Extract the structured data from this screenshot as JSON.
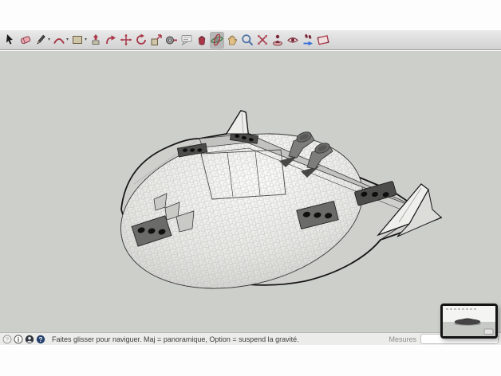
{
  "toolbar": {
    "active_tool": "orbit",
    "tools": [
      {
        "id": "select",
        "icon": "select-icon",
        "flyout": false
      },
      {
        "id": "eraser",
        "icon": "eraser-icon",
        "flyout": false
      },
      {
        "id": "line",
        "icon": "pencil-icon",
        "flyout": true
      },
      {
        "id": "arc",
        "icon": "arc-icon",
        "flyout": true
      },
      {
        "id": "shapes",
        "icon": "rectangle-icon",
        "flyout": true
      },
      {
        "id": "push-pull",
        "icon": "push-pull-icon",
        "flyout": false
      },
      {
        "id": "follow-me",
        "icon": "follow-me-icon",
        "flyout": false
      },
      {
        "id": "move",
        "icon": "move-icon",
        "flyout": false
      },
      {
        "id": "rotate",
        "icon": "rotate-icon",
        "flyout": false
      },
      {
        "id": "scale",
        "icon": "scale-icon",
        "flyout": false
      },
      {
        "id": "tape-measure",
        "icon": "tape-measure-icon",
        "flyout": false
      },
      {
        "id": "text",
        "icon": "text-label-icon",
        "flyout": false
      },
      {
        "id": "paint-bucket",
        "icon": "paint-bucket-icon",
        "flyout": false
      },
      {
        "id": "orbit",
        "icon": "orbit-icon",
        "flyout": false
      },
      {
        "id": "pan",
        "icon": "pan-hand-icon",
        "flyout": false
      },
      {
        "id": "zoom",
        "icon": "zoom-icon",
        "flyout": false
      },
      {
        "id": "zoom-extents",
        "icon": "zoom-extents-icon",
        "flyout": false
      },
      {
        "id": "position-camera",
        "icon": "position-camera-icon",
        "flyout": false
      },
      {
        "id": "look-around",
        "icon": "look-around-icon",
        "flyout": false
      },
      {
        "id": "walk",
        "icon": "walk-icon",
        "flyout": false
      },
      {
        "id": "section-plane",
        "icon": "section-plane-icon",
        "flyout": false
      }
    ]
  },
  "viewport": {
    "background_color": "#cdcfca",
    "model": "flying-saucer-aircraft-model"
  },
  "preview_window": {
    "visible": true,
    "content": "side-view-of-saucer-model"
  },
  "statusbar": {
    "icons": [
      {
        "id": "geolocation-icon"
      },
      {
        "id": "attribution-icon"
      },
      {
        "id": "account-icon"
      },
      {
        "id": "help-icon"
      }
    ],
    "hint_text": "Faites glisser pour naviguer. Maj = panoramique, Option =  suspend la gravité.",
    "measurements_label": "Mesures",
    "measurements_value": ""
  },
  "colors": {
    "toolbar_bg": "#dcdcdc",
    "active_tool_bg": "#b7b7b7",
    "canvas_bg": "#cdcfca",
    "statusbar_bg": "#ececea",
    "model_outline": "#161616",
    "accent_red": "#a83848",
    "accent_green": "#3f7d44",
    "accent_blue": "#4a6fa5"
  }
}
